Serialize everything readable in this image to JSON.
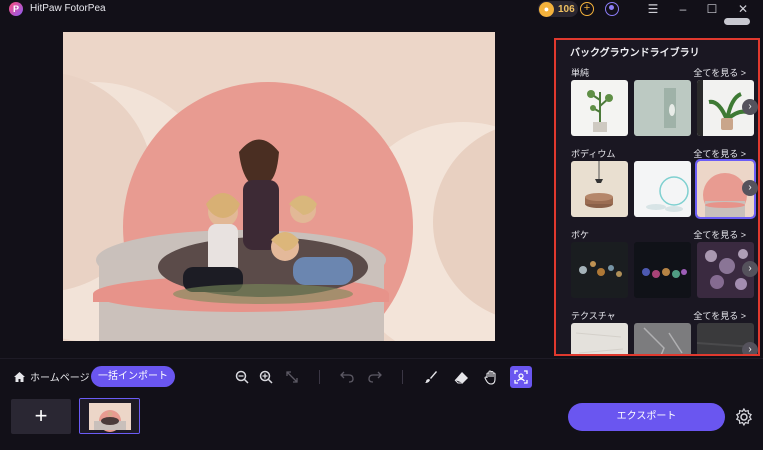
{
  "app": {
    "title": "HitPaw FotorPea",
    "logo_letter": "P"
  },
  "header": {
    "coins": "106",
    "add_coins_label": "+"
  },
  "window_controls": {
    "collapse": "⌄",
    "menu": "☰",
    "minimize": "–",
    "maximize": "☐",
    "close": "✕"
  },
  "panel": {
    "title": "バックグラウンドライブラリ",
    "sections": [
      {
        "name": "単純",
        "see_all": "全てを見る >"
      },
      {
        "name": "ボディウム",
        "see_all": "全てを見る >"
      },
      {
        "name": "ボケ",
        "see_all": "全てを見る >"
      },
      {
        "name": "テクスチャ",
        "see_all": "全てを見る >"
      }
    ],
    "next_arrow": "›"
  },
  "bottom": {
    "home_label": "ホームページ",
    "batch_import_label": "一括インポート",
    "add_label": "+",
    "export_label": "エクスポート"
  },
  "colors": {
    "accent": "#6a56f0",
    "highlight_border": "#e0392e",
    "background": "#121018"
  }
}
